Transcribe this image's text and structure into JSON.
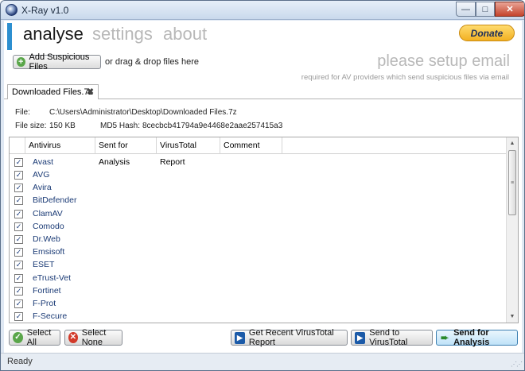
{
  "window": {
    "title": "X-Ray v1.0",
    "min": "—",
    "max": "□",
    "close": "✕"
  },
  "nav": {
    "analyse": "analyse",
    "settings": "settings",
    "about": "about",
    "donate": "Donate"
  },
  "toolbar": {
    "add_files": "Add Suspicious Files",
    "drag_hint": "or drag & drop files here"
  },
  "email": {
    "title": "please setup email",
    "subtitle": "required for AV providers which send suspicious files via email"
  },
  "tab": {
    "label": "Downloaded Files.7z",
    "close": "✖"
  },
  "file_info": {
    "file_label": "File:",
    "file_path": "C:\\Users\\Administrator\\Desktop\\Downloaded Files.7z",
    "size_label": "File size:",
    "size_value": "150 KB",
    "hash_label": "MD5 Hash:",
    "hash_value": "8cecbcb41794a9e4468e2aae257415a3"
  },
  "grid": {
    "columns": [
      "Antivirus",
      "Sent for Analysis",
      "VirusTotal Report",
      "Comment"
    ],
    "rows": [
      {
        "name": "Avast",
        "checked": true
      },
      {
        "name": "AVG",
        "checked": true
      },
      {
        "name": "Avira",
        "checked": true
      },
      {
        "name": "BitDefender",
        "checked": true
      },
      {
        "name": "ClamAV",
        "checked": true
      },
      {
        "name": "Comodo",
        "checked": true
      },
      {
        "name": "Dr.Web",
        "checked": true
      },
      {
        "name": "Emsisoft",
        "checked": true
      },
      {
        "name": "ESET",
        "checked": true
      },
      {
        "name": "eTrust-Vet",
        "checked": true
      },
      {
        "name": "Fortinet",
        "checked": true
      },
      {
        "name": "F-Prot",
        "checked": true
      },
      {
        "name": "F-Secure",
        "checked": true
      }
    ],
    "check_glyph": "✓"
  },
  "buttons": {
    "select_all": "Select All",
    "select_none": "Select None",
    "get_report": "Get Recent VirusTotal Report",
    "send_vt": "Send to VirusTotal",
    "send_analysis": "Send for Analysis"
  },
  "status": {
    "text": "Ready"
  }
}
